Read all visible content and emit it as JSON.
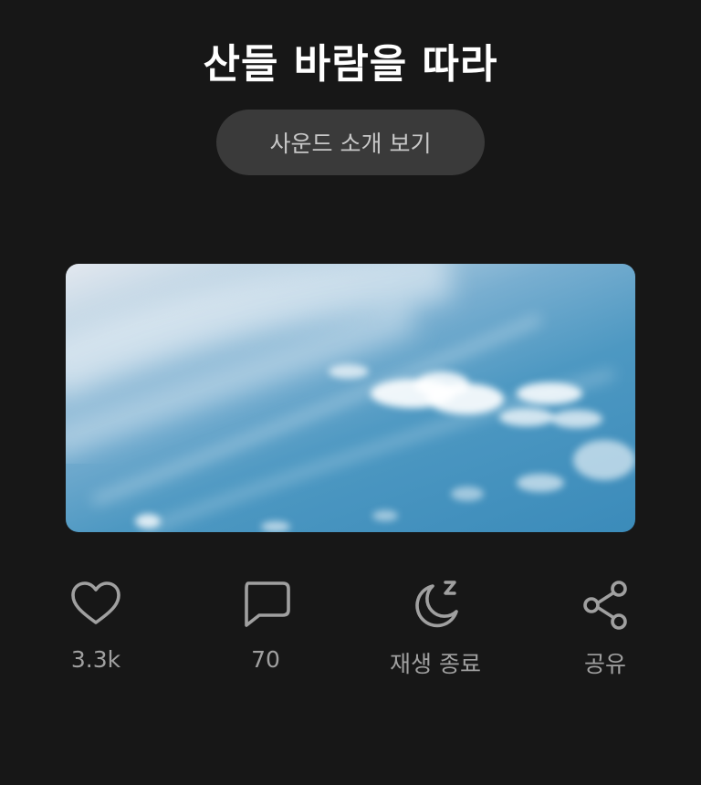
{
  "header": {
    "title": "산들 바람을 따라"
  },
  "intro_button": {
    "label": "사운드 소개 보기"
  },
  "artwork": {
    "description_icon": "sky-clouds-image"
  },
  "actions": [
    {
      "icon": "heart-icon",
      "label": "3.3k"
    },
    {
      "icon": "comment-icon",
      "label": "70"
    },
    {
      "icon": "moon-sleep-icon",
      "label": "재생 종료"
    },
    {
      "icon": "share-icon",
      "label": "공유"
    }
  ],
  "colors": {
    "background": "#171717",
    "button": "#3a3a3a",
    "icon": "#a0a0a0"
  }
}
